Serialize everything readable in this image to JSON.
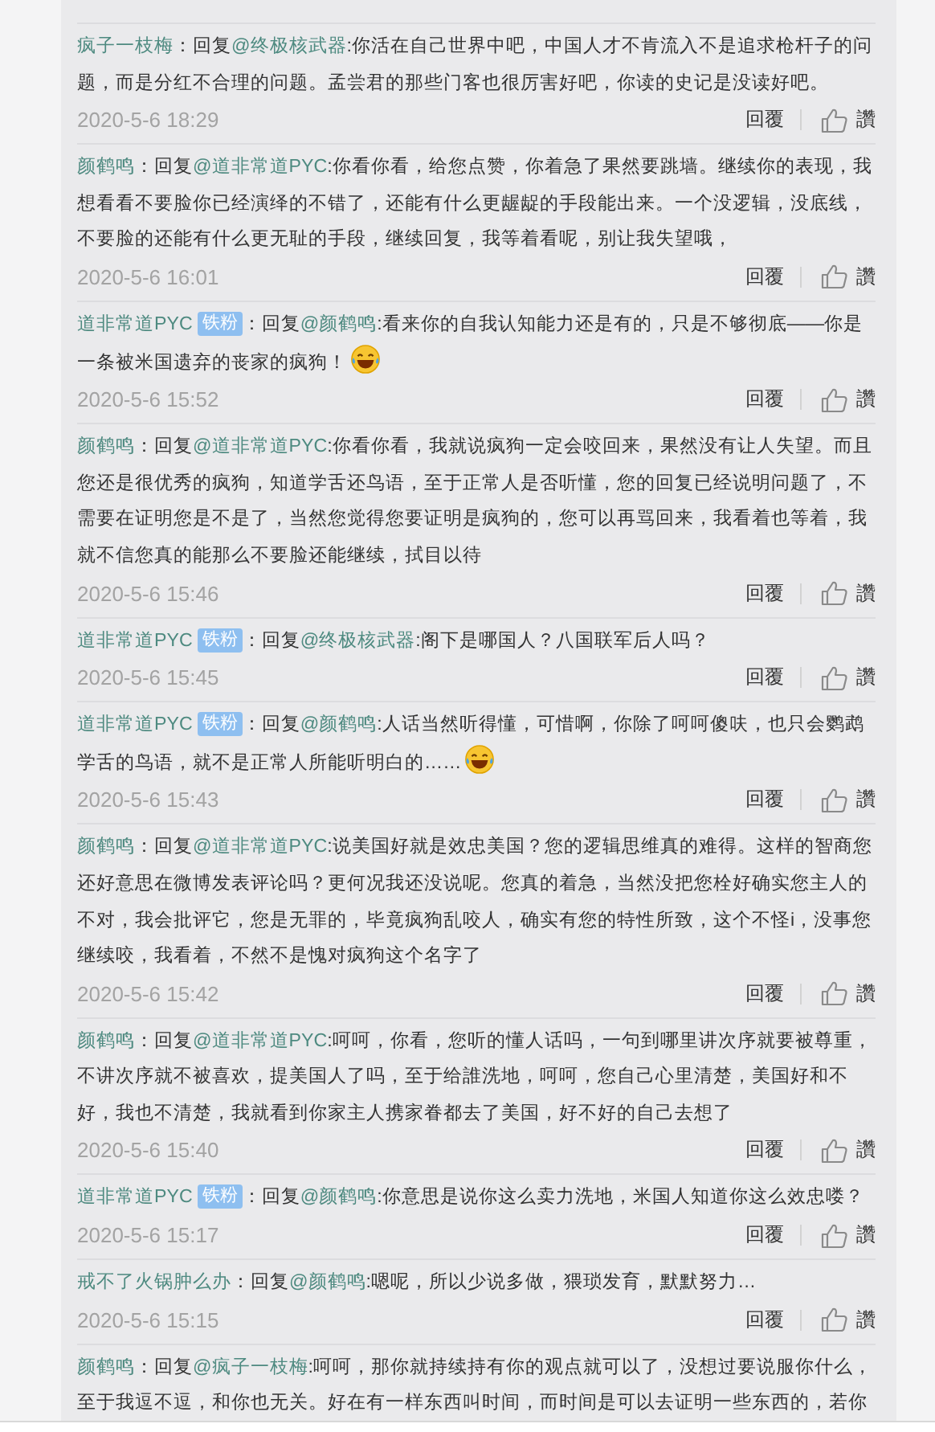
{
  "comments": [
    {
      "author": "疯子一枝梅",
      "prefix": "：回复",
      "mention": "@终极核武器",
      "text": ":你活在自己世界中吧，中国人才不肯流入不是追求枪杆子的问题，而是分红不合理的问题。孟尝君的那些门客也很厉害好吧，你读的史记是没读好吧。",
      "emoji": false,
      "time": "2020-5-6 18:29",
      "reply": "回覆",
      "like": "讚"
    },
    {
      "author": "颜鹤鸣",
      "prefix": "：回复",
      "mention": "@道非常道PYC",
      "text": ":你看你看，给您点赞，你着急了果然要跳墙。继续你的表现，我想看看不要脸你已经演绎的不错了，还能有什么更龌龊的手段能出来。一个没逻辑，没底线，不要脸的还能有什么更无耻的手段，继续回复，我等着看呢，别让我失望哦，",
      "emoji": false,
      "time": "2020-5-6 16:01",
      "reply": "回覆",
      "like": "讚"
    },
    {
      "author": "道非常道PYC",
      "badge": "铁粉",
      "prefix": "：回复",
      "mention": "@颜鹤鸣",
      "text": ":看来你的自我认知能力还是有的，只是不够彻底——你是一条被米国遗弃的丧家的疯狗！",
      "emoji": true,
      "time": "2020-5-6 15:52",
      "reply": "回覆",
      "like": "讚"
    },
    {
      "author": "颜鹤鸣",
      "prefix": "：回复",
      "mention": "@道非常道PYC",
      "text": ":你看你看，我就说疯狗一定会咬回来，果然没有让人失望。而且您还是很优秀的疯狗，知道学舌还鸟语，至于正常人是否听懂，您的回复已经说明问题了，不需要在证明您是不是了，当然您觉得您要证明是疯狗的，您可以再骂回来，我看着也等着，我就不信您真的能那么不要脸还能继续，拭目以待",
      "emoji": false,
      "time": "2020-5-6 15:46",
      "reply": "回覆",
      "like": "讚"
    },
    {
      "author": "道非常道PYC",
      "badge": "铁粉",
      "prefix": "：回复",
      "mention": "@终极核武器",
      "text": ":阁下是哪国人？八国联军后人吗？",
      "emoji": false,
      "time": "2020-5-6 15:45",
      "reply": "回覆",
      "like": "讚"
    },
    {
      "author": "道非常道PYC",
      "badge": "铁粉",
      "prefix": "：回复",
      "mention": "@颜鹤鸣",
      "text": ":人话当然听得懂，可惜啊，你除了呵呵傻呋，也只会鹦鹉学舌的鸟语，就不是正常人所能听明白的……",
      "emoji": true,
      "time": "2020-5-6 15:43",
      "reply": "回覆",
      "like": "讚"
    },
    {
      "author": "颜鹤鸣",
      "prefix": "：回复",
      "mention": "@道非常道PYC",
      "text": ":说美国好就是效忠美国？您的逻辑思维真的难得。这样的智商您还好意思在微博发表评论吗？更何况我还没说呢。您真的着急，当然没把您栓好确实您主人的不对，我会批评它，您是无罪的，毕竟疯狗乱咬人，确实有您的特性所致，这个不怪i，没事您继续咬，我看着，不然不是愧对疯狗这个名字了",
      "emoji": false,
      "time": "2020-5-6 15:42",
      "reply": "回覆",
      "like": "讚"
    },
    {
      "author": "颜鹤鸣",
      "prefix": "：回复",
      "mention": "@道非常道PYC",
      "text": ":呵呵，你看，您听的懂人话吗，一句到哪里讲次序就要被尊重，不讲次序就不被喜欢，提美国人了吗，至于给誰洗地，呵呵，您自己心里清楚，美国好和不好，我也不清楚，我就看到你家主人携家眷都去了美国，好不好的自己去想了",
      "emoji": false,
      "time": "2020-5-6 15:40",
      "reply": "回覆",
      "like": "讚"
    },
    {
      "author": "道非常道PYC",
      "badge": "铁粉",
      "prefix": "：回复",
      "mention": "@颜鹤鸣",
      "text": ":你意思是说你这么卖力洗地，米国人知道你这么效忠喽？",
      "emoji": false,
      "time": "2020-5-6 15:17",
      "reply": "回覆",
      "like": "讚"
    },
    {
      "author": "戒不了火锅肿么办",
      "prefix": "：回复",
      "mention": "@颜鹤鸣",
      "text": ":嗯呢，所以少说多做，猥琐发育，默默努力…",
      "emoji": false,
      "time": "2020-5-6 15:15",
      "reply": "回覆",
      "like": "讚"
    },
    {
      "author": "颜鹤鸣",
      "prefix": "：回复",
      "mention": "@疯子一枝梅",
      "text": ":呵呵，那你就持续持有你的观点就可以了，没想过要说服你什么，至于我逗不逗，和你也无关。好在有一样东西叫时间，而时间是可以去证明一些东西的，若你",
      "emoji": false
    }
  ]
}
